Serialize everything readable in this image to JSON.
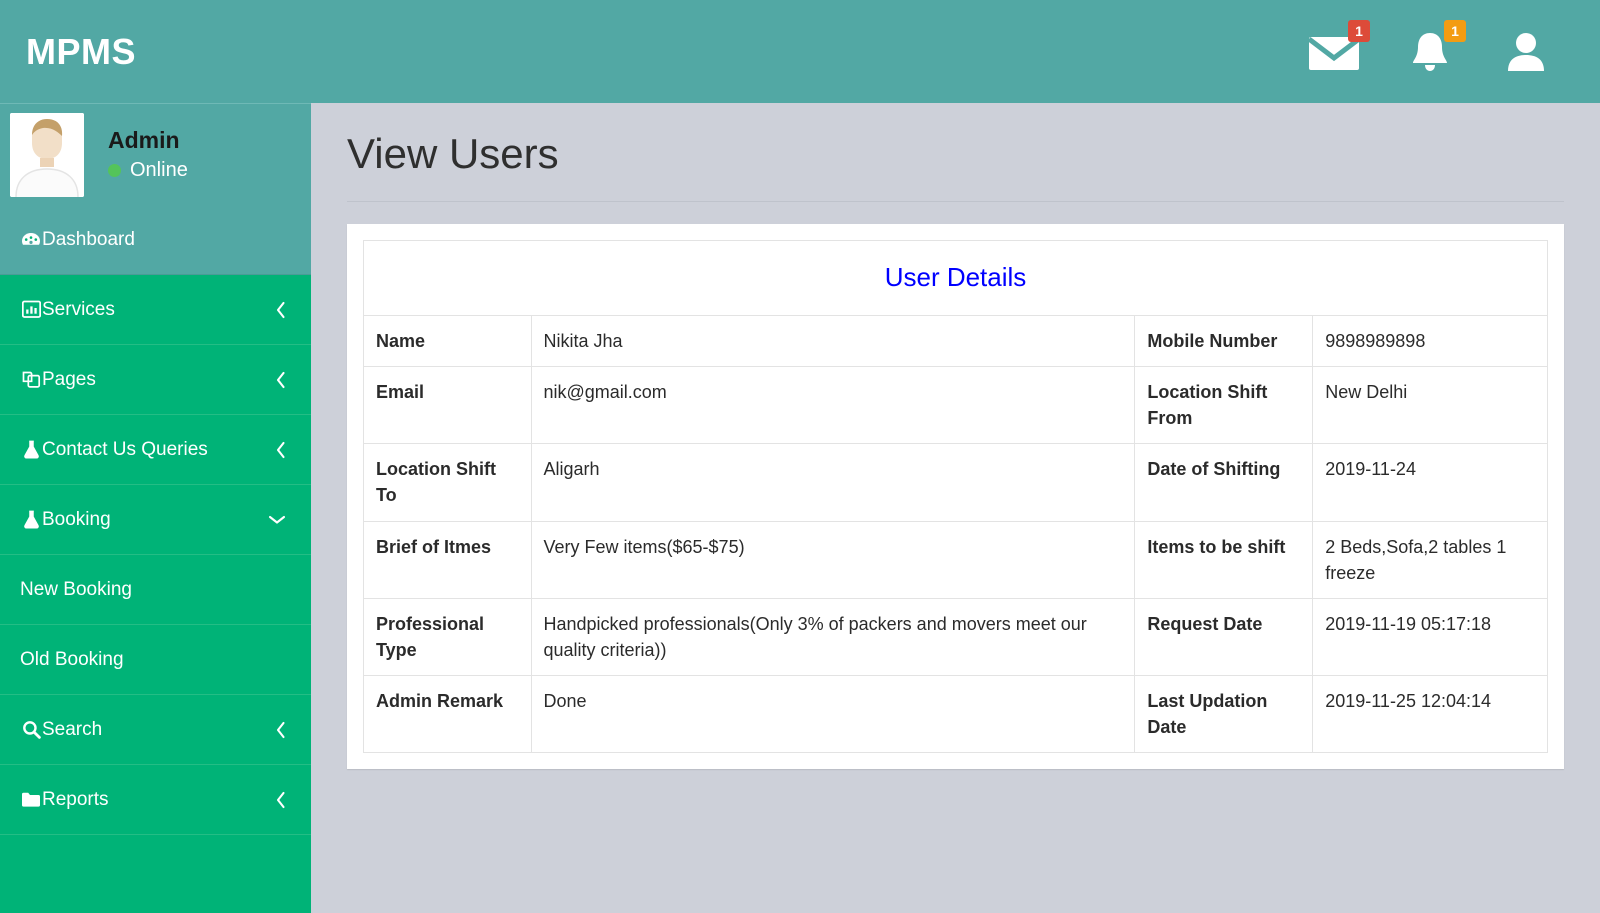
{
  "colors": {
    "header_teal": "#52a8a4",
    "sidebar_green": "#00b377",
    "content_bg": "#cdd0d9",
    "caption_blue": "#0000ff",
    "badge_red": "#dd4b39",
    "badge_orange": "#f39c12",
    "online_green": "#54c45a"
  },
  "header": {
    "brand": "MPMS",
    "messages_icon": "envelope-icon",
    "messages_count": "1",
    "notifications_icon": "bell-icon",
    "notifications_count": "1",
    "account_icon": "user-icon"
  },
  "sidebar": {
    "user": {
      "name": "Admin",
      "status": "Online",
      "avatar_icon": "avatar-image"
    },
    "items": [
      {
        "label": "Dashboard",
        "icon": "dashboard-icon",
        "arrow": "",
        "style": "teal",
        "sub": false
      },
      {
        "label": "Services",
        "icon": "chart-bar-icon",
        "arrow": "left",
        "style": "green",
        "sub": false
      },
      {
        "label": "Pages",
        "icon": "copy-icon",
        "arrow": "left",
        "style": "green",
        "sub": false
      },
      {
        "label": "Contact Us Queries",
        "icon": "flask-icon",
        "arrow": "left",
        "style": "green",
        "sub": false
      },
      {
        "label": "Booking",
        "icon": "flask-icon",
        "arrow": "down",
        "style": "green",
        "sub": false
      },
      {
        "label": "New Booking",
        "icon": "",
        "arrow": "",
        "style": "green",
        "sub": true
      },
      {
        "label": "Old Booking",
        "icon": "",
        "arrow": "",
        "style": "green",
        "sub": true
      },
      {
        "label": "Search",
        "icon": "search-icon",
        "arrow": "left",
        "style": "green",
        "sub": false
      },
      {
        "label": "Reports",
        "icon": "folder-icon",
        "arrow": "left",
        "style": "green",
        "sub": false
      }
    ]
  },
  "main": {
    "page_title": "View Users",
    "card": {
      "caption": "User Details",
      "rows": [
        {
          "left_label": "Name",
          "left_value": "Nikita Jha",
          "right_label": "Mobile Number",
          "right_value": "9898989898"
        },
        {
          "left_label": "Email",
          "left_value": "nik@gmail.com",
          "right_label": "Location Shift From",
          "right_value": "New Delhi"
        },
        {
          "left_label": "Location Shift To",
          "left_value": "Aligarh",
          "right_label": "Date of Shifting",
          "right_value": "2019-11-24"
        },
        {
          "left_label": "Brief of Itmes",
          "left_value": "Very Few items($65-$75)",
          "right_label": "Items to be shift",
          "right_value": "2 Beds,Sofa,2 tables 1 freeze"
        },
        {
          "left_label": "Professional Type",
          "left_value": "Handpicked professionals(Only 3% of packers and movers meet our quality criteria))",
          "right_label": "Request Date",
          "right_value": "2019-11-19 05:17:18"
        },
        {
          "left_label": "Admin Remark",
          "left_value": "Done",
          "right_label": "Last Updation Date",
          "right_value": "2019-11-25 12:04:14"
        }
      ]
    }
  }
}
